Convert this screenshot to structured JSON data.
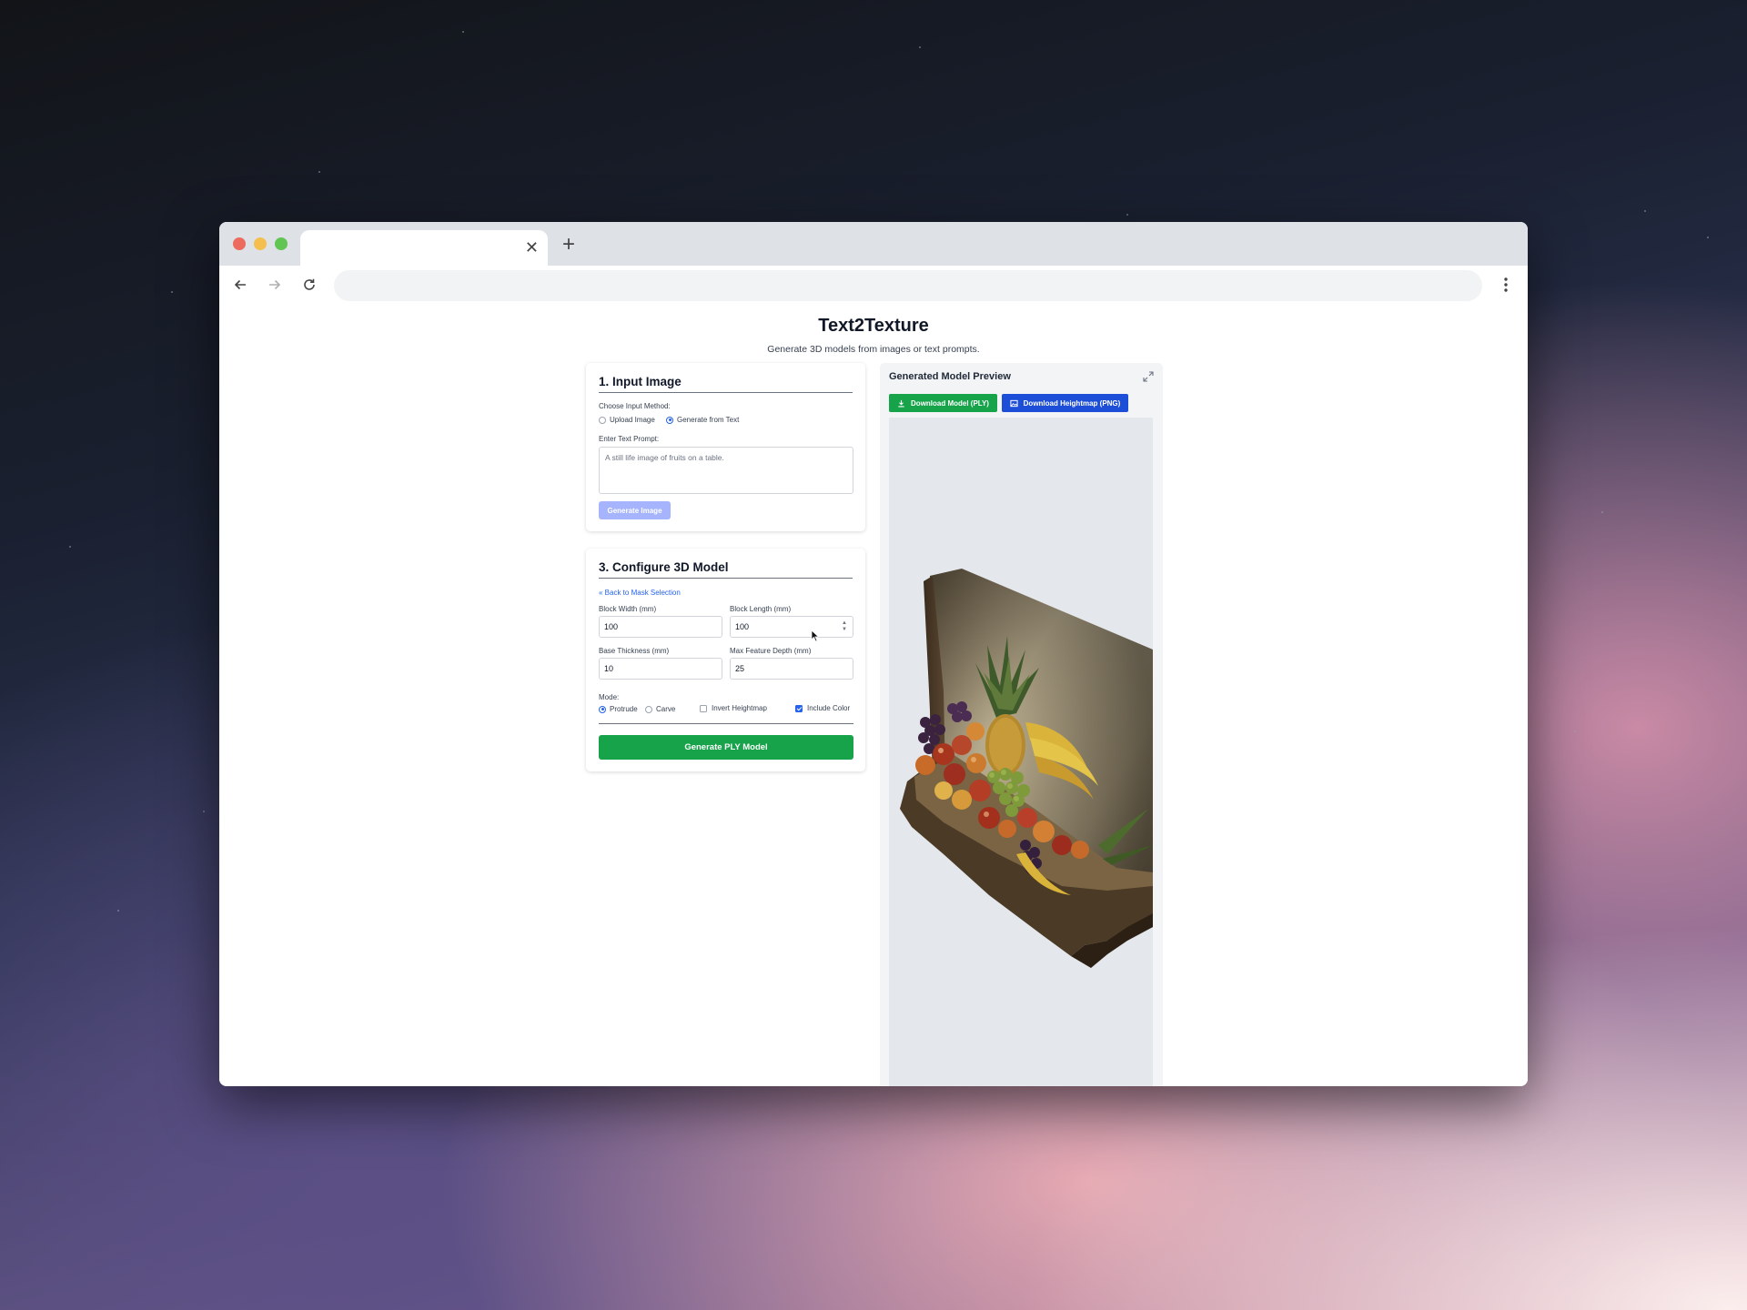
{
  "browser": {
    "tab_close": "✕",
    "new_tab": "+",
    "address": ""
  },
  "app": {
    "title": "Text2Texture",
    "subtitle": "Generate 3D models from images or text prompts."
  },
  "input_section": {
    "heading": "1. Input Image",
    "method_label": "Choose Input Method:",
    "method_upload": "Upload Image",
    "method_text": "Generate from Text",
    "method_selected": "Generate from Text",
    "prompt_label": "Enter Text Prompt:",
    "prompt_placeholder": "A still life image of fruits on a table.",
    "generate_button": "Generate Image"
  },
  "config_section": {
    "heading": "3. Configure 3D Model",
    "back_link": "« Back to Mask Selection",
    "block_width_label": "Block Width (mm)",
    "block_width": "100",
    "block_length_label": "Block Length (mm)",
    "block_length": "100",
    "base_thickness_label": "Base Thickness (mm)",
    "base_thickness": "10",
    "max_depth_label": "Max Feature Depth (mm)",
    "max_depth": "25",
    "mode_label": "Mode:",
    "mode_protrude": "Protrude",
    "mode_carve": "Carve",
    "mode_selected": "Protrude",
    "invert_label": "Invert Heightmap",
    "invert_checked": false,
    "color_label": "Include Color",
    "color_checked": true,
    "generate_button": "Generate PLY Model"
  },
  "preview": {
    "title": "Generated Model Preview",
    "download_ply": "Download Model (PLY)",
    "download_heightmap": "Download Heightmap (PNG)",
    "model_subject": "fruit bowl relief model"
  },
  "colors": {
    "green": "#16a34a",
    "blue": "#1d4ed8",
    "accent": "#2563eb",
    "disabled_button": "#a5b4fc"
  }
}
